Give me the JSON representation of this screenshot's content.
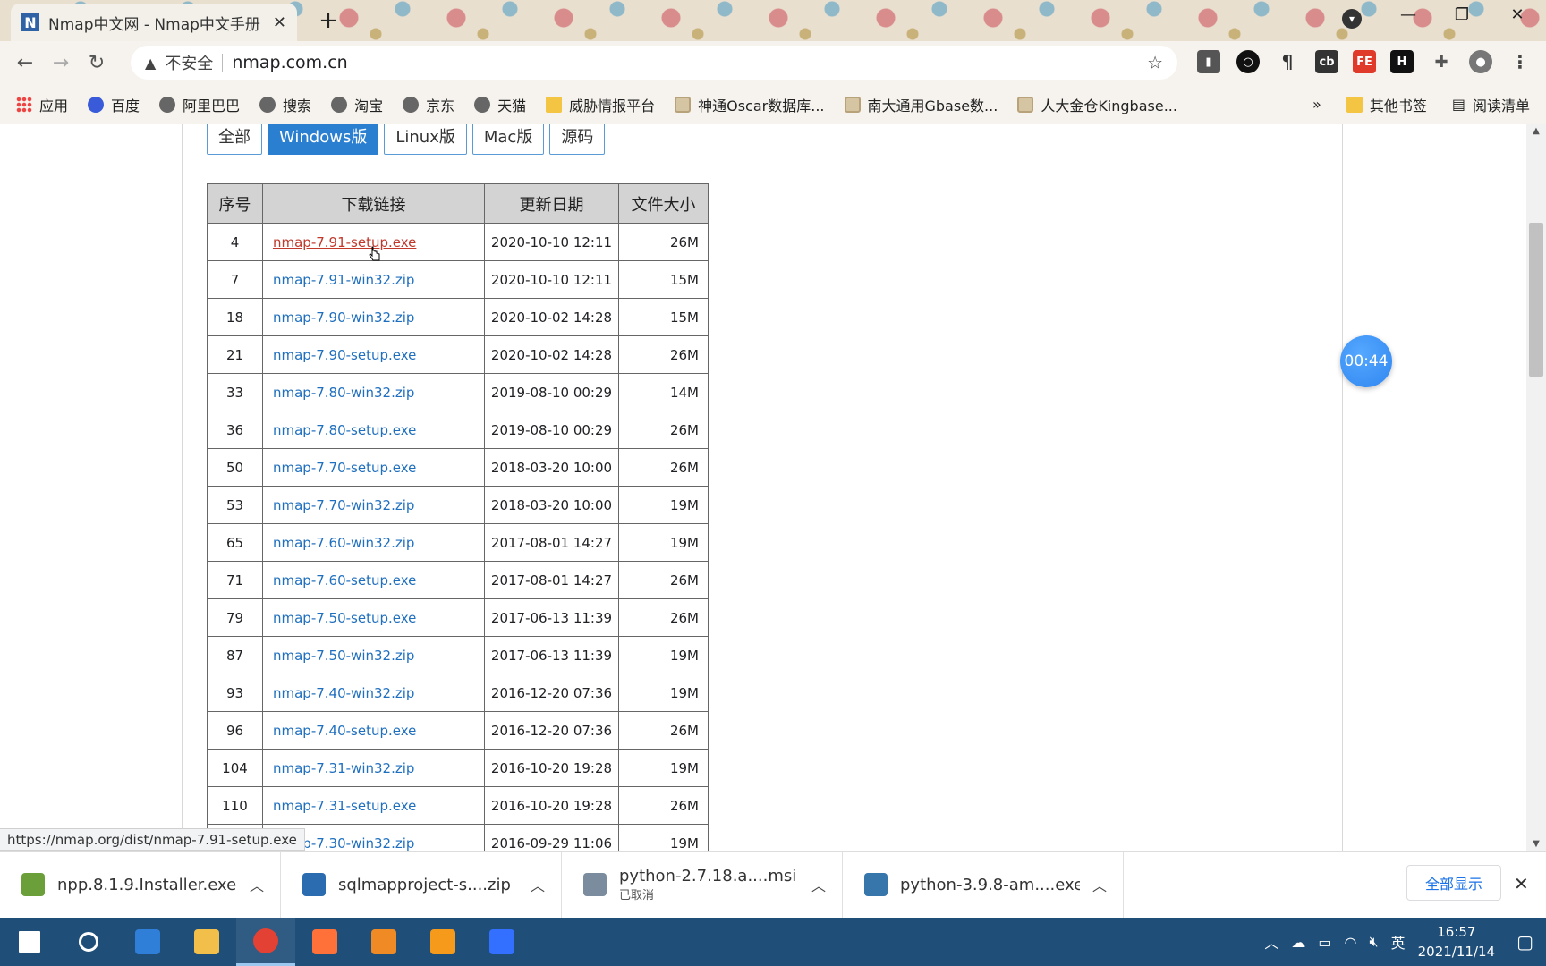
{
  "browser": {
    "tab_title": "Nmap中文网 - Nmap中文手册",
    "tab_favicon": "N",
    "security_label": "不安全",
    "url": "nmap.com.cn",
    "status_url": "https://nmap.org/dist/nmap-7.91-setup.exe"
  },
  "bookmarks": [
    {
      "label": "应用",
      "icon": "apps-icon"
    },
    {
      "label": "百度",
      "icon": "baidu-paw-icon"
    },
    {
      "label": "阿里巴巴",
      "icon": "globe-icon"
    },
    {
      "label": "搜索",
      "icon": "globe-icon"
    },
    {
      "label": "淘宝",
      "icon": "globe-icon"
    },
    {
      "label": "京东",
      "icon": "globe-icon"
    },
    {
      "label": "天猫",
      "icon": "globe-icon"
    },
    {
      "label": "威胁情报平台",
      "icon": "folder-icon"
    },
    {
      "label": "神通Oscar数据库...",
      "icon": "database-icon"
    },
    {
      "label": "南大通用Gbase数...",
      "icon": "database-icon"
    },
    {
      "label": "人大金仓Kingbase...",
      "icon": "database-icon"
    }
  ],
  "bookmarks_right": {
    "more": "»",
    "other": "其他书签",
    "reading_list": "阅读清单"
  },
  "filters": {
    "all": "全部",
    "windows": "Windows版",
    "linux": "Linux版",
    "mac": "Mac版",
    "source": "源码"
  },
  "table": {
    "headers": [
      "序号",
      "下载链接",
      "更新日期",
      "文件大小"
    ],
    "rows": [
      {
        "idx": "4",
        "name": "nmap-7.91-setup.exe",
        "date": "2020-10-10 12:11",
        "size": "26M"
      },
      {
        "idx": "7",
        "name": "nmap-7.91-win32.zip",
        "date": "2020-10-10 12:11",
        "size": "15M"
      },
      {
        "idx": "18",
        "name": "nmap-7.90-win32.zip",
        "date": "2020-10-02 14:28",
        "size": "15M"
      },
      {
        "idx": "21",
        "name": "nmap-7.90-setup.exe",
        "date": "2020-10-02 14:28",
        "size": "26M"
      },
      {
        "idx": "33",
        "name": "nmap-7.80-win32.zip",
        "date": "2019-08-10 00:29",
        "size": "14M"
      },
      {
        "idx": "36",
        "name": "nmap-7.80-setup.exe",
        "date": "2019-08-10 00:29",
        "size": "26M"
      },
      {
        "idx": "50",
        "name": "nmap-7.70-setup.exe",
        "date": "2018-03-20 10:00",
        "size": "26M"
      },
      {
        "idx": "53",
        "name": "nmap-7.70-win32.zip",
        "date": "2018-03-20 10:00",
        "size": "19M"
      },
      {
        "idx": "65",
        "name": "nmap-7.60-win32.zip",
        "date": "2017-08-01 14:27",
        "size": "19M"
      },
      {
        "idx": "71",
        "name": "nmap-7.60-setup.exe",
        "date": "2017-08-01 14:27",
        "size": "26M"
      },
      {
        "idx": "79",
        "name": "nmap-7.50-setup.exe",
        "date": "2017-06-13 11:39",
        "size": "26M"
      },
      {
        "idx": "87",
        "name": "nmap-7.50-win32.zip",
        "date": "2017-06-13 11:39",
        "size": "19M"
      },
      {
        "idx": "93",
        "name": "nmap-7.40-win32.zip",
        "date": "2016-12-20 07:36",
        "size": "19M"
      },
      {
        "idx": "96",
        "name": "nmap-7.40-setup.exe",
        "date": "2016-12-20 07:36",
        "size": "26M"
      },
      {
        "idx": "104",
        "name": "nmap-7.31-win32.zip",
        "date": "2016-10-20 19:28",
        "size": "19M"
      },
      {
        "idx": "110",
        "name": "nmap-7.31-setup.exe",
        "date": "2016-10-20 19:28",
        "size": "26M"
      },
      {
        "idx": "",
        "name": "nmap-7.30-win32.zip",
        "date": "2016-09-29 11:06",
        "size": "19M"
      }
    ]
  },
  "timer": "00:44",
  "downloads": [
    {
      "name": "npp.8.1.9.Installer.exe",
      "sub": "",
      "icon": "npp-installer-icon",
      "color": "#6a9f3a"
    },
    {
      "name": "sqlmapproject-s....zip",
      "sub": "",
      "icon": "zip-file-icon",
      "color": "#2b6cb0"
    },
    {
      "name": "python-2.7.18.a....msi",
      "sub": "已取消",
      "icon": "msi-installer-icon",
      "color": "#7a8c9e"
    },
    {
      "name": "python-3.9.8-am....exe",
      "sub": "",
      "icon": "python-installer-icon",
      "color": "#3776ab"
    }
  ],
  "show_all": "全部显示",
  "taskbar": {
    "apps": [
      {
        "name": "windows-start-icon",
        "color": "#ffffff"
      },
      {
        "name": "search-icon",
        "color": "#ffffff"
      },
      {
        "name": "virtualbox-icon",
        "color": "#2f7ed8"
      },
      {
        "name": "file-explorer-icon",
        "color": "#f2c04a"
      },
      {
        "name": "chrome-icon",
        "color": "#e34133"
      },
      {
        "name": "firefox-icon",
        "color": "#ff7139"
      },
      {
        "name": "magnifier-app-icon",
        "color": "#f08a24"
      },
      {
        "name": "sublime-text-icon",
        "color": "#f59a1b"
      },
      {
        "name": "feishu-icon",
        "color": "#3370ff"
      }
    ],
    "ime": "英",
    "time": "16:57",
    "date": "2021/11/14"
  }
}
